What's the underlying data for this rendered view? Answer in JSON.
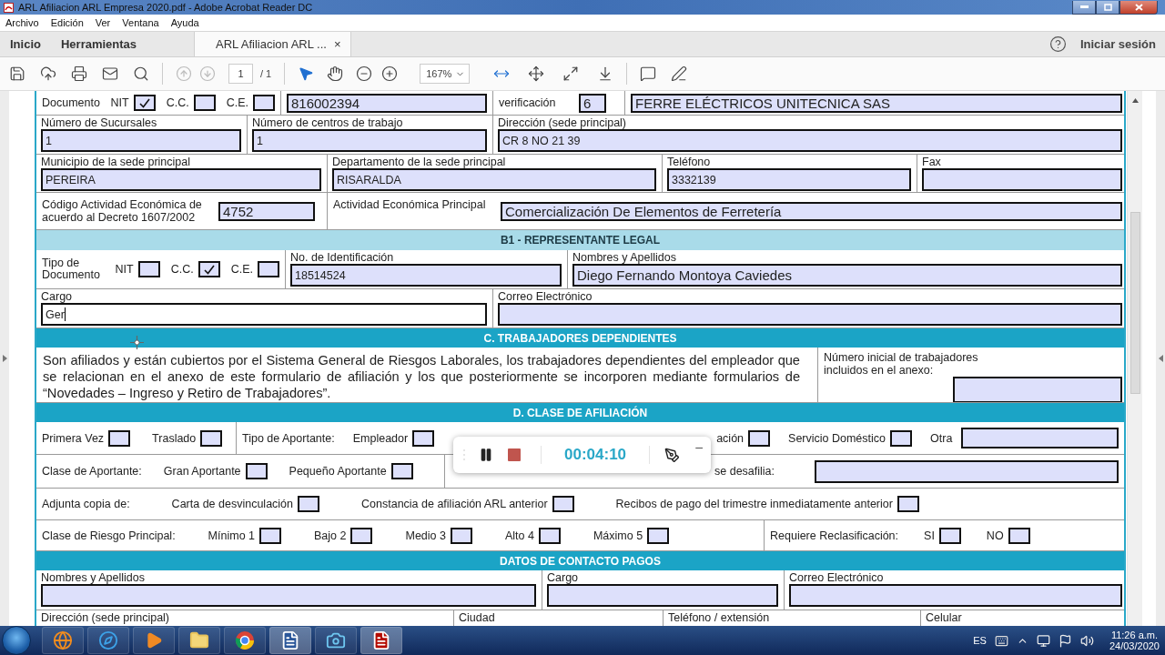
{
  "window": {
    "title": "ARL Afiliacion ARL Empresa 2020.pdf - Adobe Acrobat Reader DC"
  },
  "menu": [
    "Archivo",
    "Edición",
    "Ver",
    "Ventana",
    "Ayuda"
  ],
  "nav_tabs": [
    {
      "label": "Inicio",
      "selected": false
    },
    {
      "label": "Herramientas",
      "selected": false
    },
    {
      "label": "ARL Afiliacion ARL ...",
      "selected": true,
      "close": "×"
    }
  ],
  "sign_in": "Iniciar sesión",
  "toolbar": {
    "page": "1",
    "page_total": "/ 1",
    "zoom": "167%"
  },
  "form": {
    "rows": [
      {
        "kind": "cells",
        "cells": [
          {
            "label": "Documento",
            "checks": [
              {
                "label": "NIT",
                "checked": true
              },
              {
                "label": "C.C.",
                "checked": false
              },
              {
                "label": "C.E.",
                "checked": false
              }
            ]
          },
          {
            "value": "816002394"
          },
          {
            "label": "verificación",
            "value": "6"
          },
          {
            "value": "FERRE ELÉCTRICOS UNITECNICA SAS"
          }
        ]
      },
      {
        "kind": "cells",
        "cells": [
          {
            "label": "Número de Sucursales",
            "value": "1"
          },
          {
            "label": "Número de centros de trabajo",
            "value": "1"
          },
          {
            "label": "Dirección (sede principal)",
            "value": "CR 8 NO 21 39"
          }
        ]
      },
      {
        "kind": "cells",
        "cells": [
          {
            "label": "Municipio de la sede principal",
            "value": "PEREIRA"
          },
          {
            "label": "Departamento de la sede principal",
            "value": "RISARALDA"
          },
          {
            "label": "Teléfono",
            "value": "3332139"
          },
          {
            "label": "Fax"
          }
        ]
      },
      {
        "kind": "cells",
        "cells": [
          {
            "label": "Código Actividad Económica de acuerdo al Decreto 1607/2002",
            "value": "4752"
          },
          {
            "label": "Actividad Económica Principal",
            "value": "Comercialización De Elementos de Ferretería"
          }
        ]
      },
      {
        "kind": "subheader",
        "text": "B1 - REPRESENTANTE LEGAL"
      },
      {
        "kind": "cells",
        "cells": [
          {
            "label": "Tipo de Documento",
            "checks": [
              {
                "label": "NIT",
                "checked": false
              },
              {
                "label": "C.C.",
                "checked": true
              },
              {
                "label": "C.E.",
                "checked": false
              }
            ]
          },
          {
            "label": "No. de Identificación",
            "value": "18514524"
          },
          {
            "label": "Nombres y Apellidos",
            "value": "Diego Fernando Montoya Caviedes"
          }
        ]
      },
      {
        "kind": "cells",
        "cells": [
          {
            "label": "Cargo",
            "value": "Ger",
            "focused": true
          },
          {
            "label": "Correo Electrónico"
          }
        ]
      },
      {
        "kind": "header",
        "text": "C.  TRABAJADORES DEPENDIENTES"
      },
      {
        "kind": "cells",
        "cells": [
          {
            "paragraph": "Son afiliados y están cubiertos por el Sistema General de Riesgos Laborales, los trabajadores dependientes del empleador que se relacionan en el anexo de este formulario de afiliación y los que posteriormente se incorporen mediante formularios de “Novedades – Ingreso y Retiro de Trabajadores”."
          },
          {
            "label": "Número inicial de trabajadores incluidos en el anexo:"
          }
        ]
      },
      {
        "kind": "header",
        "text": "D.  CLASE DE AFILIACIÓN"
      },
      {
        "kind": "inline",
        "segments": [
          {
            "items": [
              {
                "kind": "check",
                "label": "Primera Vez",
                "checked": false
              },
              {
                "kind": "check",
                "label": "Traslado",
                "checked": false
              }
            ]
          },
          {
            "items": [
              {
                "kind": "text",
                "text": "Tipo de Aportante:"
              },
              {
                "kind": "check",
                "label": "Empleador",
                "checked": false
              },
              {
                "kind": "check",
                "label": "ación",
                "checked": false
              },
              {
                "kind": "check",
                "label": "Servicio Doméstico",
                "checked": false
              },
              {
                "kind": "field",
                "label": "Otra"
              }
            ]
          }
        ]
      },
      {
        "kind": "inline",
        "segments": [
          {
            "items": [
              {
                "kind": "text",
                "text": "Clase de Aportante:"
              },
              {
                "kind": "check",
                "label": "Gran Aportante",
                "checked": false
              },
              {
                "kind": "check",
                "label": "Pequeño Aportante",
                "checked": false
              }
            ]
          },
          {
            "items": [
              {
                "kind": "field",
                "label": "se desafilia:"
              }
            ]
          }
        ]
      },
      {
        "kind": "inline",
        "segments": [
          {
            "items": [
              {
                "kind": "text",
                "text": "Adjunta copia de:"
              },
              {
                "kind": "check",
                "label": "Carta de desvinculación",
                "checked": false
              },
              {
                "kind": "check",
                "label": "Constancia de afiliación ARL anterior",
                "checked": false
              },
              {
                "kind": "check",
                "label": "Recibos de pago del trimestre inmediatamente anterior",
                "checked": false
              }
            ]
          }
        ]
      },
      {
        "kind": "inline",
        "segments": [
          {
            "items": [
              {
                "kind": "text",
                "text": "Clase de Riesgo Principal:"
              },
              {
                "kind": "check",
                "label": "Mínimo 1",
                "checked": false
              },
              {
                "kind": "check",
                "label": "Bajo 2",
                "checked": false
              },
              {
                "kind": "check",
                "label": "Medio 3",
                "checked": false
              },
              {
                "kind": "check",
                "label": "Alto 4",
                "checked": false
              },
              {
                "kind": "check",
                "label": "Máximo 5",
                "checked": false
              }
            ]
          },
          {
            "items": [
              {
                "kind": "text",
                "text": "Requiere Reclasificación:"
              },
              {
                "kind": "check",
                "label": "SI",
                "checked": false
              },
              {
                "kind": "check",
                "label": "NO",
                "checked": false
              }
            ]
          }
        ]
      },
      {
        "kind": "header",
        "text": "DATOS DE CONTACTO PAGOS"
      },
      {
        "kind": "cells",
        "cells": [
          {
            "label": "Nombres y Apellidos"
          },
          {
            "label": "Cargo"
          },
          {
            "label": "Correo Electrónico"
          }
        ]
      },
      {
        "kind": "cells",
        "cells": [
          {
            "label": "Dirección (sede principal)"
          },
          {
            "label": "Ciudad"
          },
          {
            "label": "Teléfono / extensión"
          },
          {
            "label": "Celular"
          }
        ]
      }
    ]
  },
  "recorder": {
    "time": "00:04:10",
    "minimize": "–"
  },
  "taskbar": {
    "language": "ES",
    "time": "11:26 a.m.",
    "date": "24/03/2020"
  }
}
